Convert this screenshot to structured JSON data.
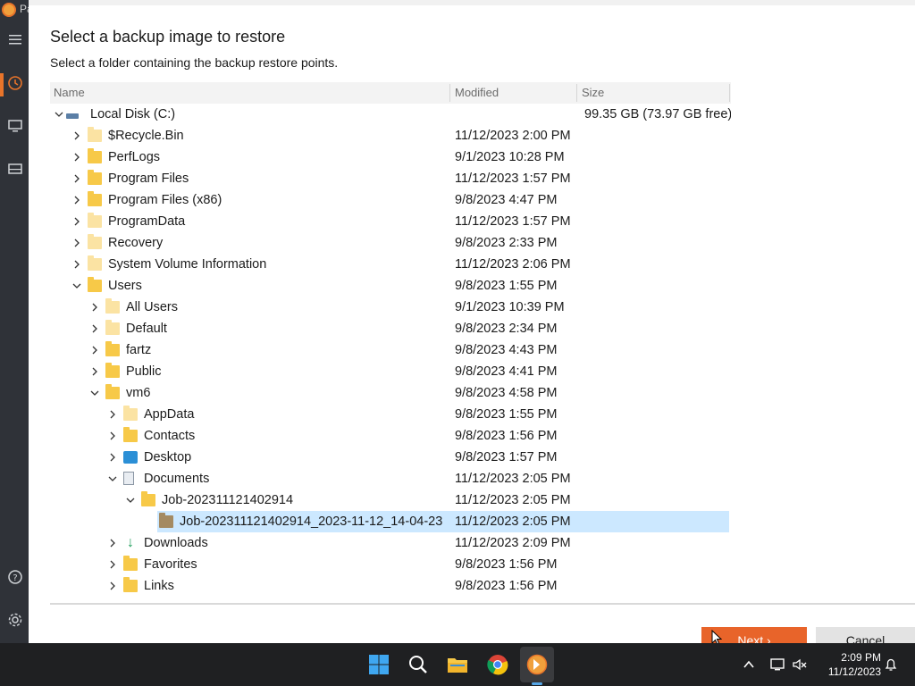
{
  "background_app": {
    "title_fragment": "Pa",
    "sidebar_icons": [
      "menu-icon",
      "clock-icon",
      "monitor-icon",
      "drive-icon",
      "help-icon",
      "settings-icon"
    ]
  },
  "dialog": {
    "title": "Select a backup image to restore",
    "subtitle": "Select a folder containing the backup restore points.",
    "columns": {
      "name": "Name",
      "modified": "Modified",
      "size": "Size"
    },
    "rows": [
      {
        "name": "Local Disk (C:)",
        "modified": "",
        "size": "99.35 GB (73.97 GB free)",
        "level": 0,
        "expander": "down",
        "icon": "disk"
      },
      {
        "name": "$Recycle.Bin",
        "modified": "11/12/2023 2:00 PM",
        "size": "",
        "level": 1,
        "expander": "right",
        "icon": "folder-light"
      },
      {
        "name": "PerfLogs",
        "modified": "9/1/2023 10:28 PM",
        "size": "",
        "level": 1,
        "expander": "right",
        "icon": "folder"
      },
      {
        "name": "Program Files",
        "modified": "11/12/2023 1:57 PM",
        "size": "",
        "level": 1,
        "expander": "right",
        "icon": "folder"
      },
      {
        "name": "Program Files (x86)",
        "modified": "9/8/2023 4:47 PM",
        "size": "",
        "level": 1,
        "expander": "right",
        "icon": "folder"
      },
      {
        "name": "ProgramData",
        "modified": "11/12/2023 1:57 PM",
        "size": "",
        "level": 1,
        "expander": "right",
        "icon": "folder-light"
      },
      {
        "name": "Recovery",
        "modified": "9/8/2023 2:33 PM",
        "size": "",
        "level": 1,
        "expander": "right",
        "icon": "folder-light"
      },
      {
        "name": "System Volume Information",
        "modified": "11/12/2023 2:06 PM",
        "size": "",
        "level": 1,
        "expander": "right",
        "icon": "folder-light"
      },
      {
        "name": "Users",
        "modified": "9/8/2023 1:55 PM",
        "size": "",
        "level": 1,
        "expander": "down",
        "icon": "folder"
      },
      {
        "name": "All Users",
        "modified": "9/1/2023 10:39 PM",
        "size": "",
        "level": 2,
        "expander": "right",
        "icon": "folder-light"
      },
      {
        "name": "Default",
        "modified": "9/8/2023 2:34 PM",
        "size": "",
        "level": 2,
        "expander": "right",
        "icon": "folder-light"
      },
      {
        "name": "fartz",
        "modified": "9/8/2023 4:43 PM",
        "size": "",
        "level": 2,
        "expander": "right",
        "icon": "folder"
      },
      {
        "name": "Public",
        "modified": "9/8/2023 4:41 PM",
        "size": "",
        "level": 2,
        "expander": "right",
        "icon": "folder"
      },
      {
        "name": "vm6",
        "modified": "9/8/2023 4:58 PM",
        "size": "",
        "level": 2,
        "expander": "down",
        "icon": "folder"
      },
      {
        "name": "AppData",
        "modified": "9/8/2023 1:55 PM",
        "size": "",
        "level": 3,
        "expander": "right",
        "icon": "folder-light"
      },
      {
        "name": "Contacts",
        "modified": "9/8/2023 1:56 PM",
        "size": "",
        "level": 3,
        "expander": "right",
        "icon": "folder"
      },
      {
        "name": "Desktop",
        "modified": "9/8/2023 1:57 PM",
        "size": "",
        "level": 3,
        "expander": "right",
        "icon": "desktop"
      },
      {
        "name": "Documents",
        "modified": "11/12/2023 2:05 PM",
        "size": "",
        "level": 3,
        "expander": "down",
        "icon": "document"
      },
      {
        "name": "Job-202311121402914",
        "modified": "11/12/2023 2:05 PM",
        "size": "",
        "level": 4,
        "expander": "down",
        "icon": "folder"
      },
      {
        "name": "Job-202311121402914_2023-11-12_14-04-23",
        "modified": "11/12/2023 2:05 PM",
        "size": "",
        "level": 5,
        "expander": "none",
        "icon": "folder-dark",
        "selected": true
      },
      {
        "name": "Downloads",
        "modified": "11/12/2023 2:09 PM",
        "size": "",
        "level": 3,
        "expander": "right",
        "icon": "download"
      },
      {
        "name": "Favorites",
        "modified": "9/8/2023 1:56 PM",
        "size": "",
        "level": 3,
        "expander": "right",
        "icon": "folder"
      },
      {
        "name": "Links",
        "modified": "9/8/2023 1:56 PM",
        "size": "",
        "level": 3,
        "expander": "right",
        "icon": "folder"
      }
    ],
    "buttons": {
      "next": "Next ›",
      "cancel": "Cancel"
    }
  },
  "taskbar": {
    "apps": [
      "start-icon",
      "search-icon",
      "file-explorer-icon",
      "chrome-icon",
      "backup-app-icon"
    ],
    "tray_icons": [
      "chevron-up-icon",
      "display-icon",
      "speaker-muted-icon",
      "notification-bell-icon"
    ],
    "time": "2:09 PM",
    "date": "11/12/2023"
  },
  "colors": {
    "accent": "#e8642a",
    "selection": "#cce8ff",
    "taskbar": "#1f2022"
  }
}
